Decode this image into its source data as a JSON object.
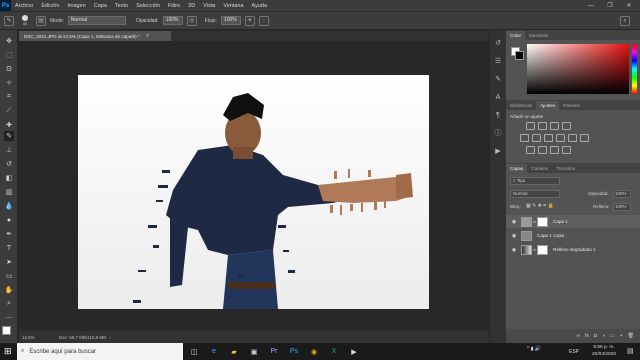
{
  "menu": {
    "app_icon": "Ps",
    "items": [
      "Archivo",
      "Edición",
      "Imagen",
      "Capa",
      "Texto",
      "Selección",
      "Filtro",
      "3D",
      "Vista",
      "Ventana",
      "Ayuda"
    ]
  },
  "options": {
    "brush_size": "40",
    "mode_label": "Modo:",
    "mode_value": "Normal",
    "opacity_label": "Opacidad:",
    "opacity_value": "100%",
    "flow_label": "Flujo:",
    "flow_value": "100%"
  },
  "document": {
    "tab_title": "DSC_5041.JPG al 12,5% (Capa 1, Máscara de capa/8) *",
    "zoom": "12,5%",
    "doc_info": "Doc: 66,7 MB/110,8 MB"
  },
  "color_panel": {
    "tabs": [
      "Color",
      "Muestras"
    ],
    "foreground": "#ffffff",
    "background": "#000000"
  },
  "adjust_panel": {
    "tabs": [
      "Bibliotecas",
      "Ajustes",
      "Paneles"
    ],
    "title": "Añadir un ajuste"
  },
  "layers_panel": {
    "tabs": [
      "Capas",
      "Canales",
      "Trazados"
    ],
    "filter_label": "Tipo",
    "blend_mode": "Normal",
    "opacity_label": "Opacidad:",
    "opacity_value": "100%",
    "lock_label": "Bloq.:",
    "fill_label": "Relleno:",
    "fill_value": "100%",
    "layers": [
      {
        "name": "Capa 1",
        "selected": true
      },
      {
        "name": "Capa 1 copia",
        "selected": false
      },
      {
        "name": "Relleno degradado 1",
        "selected": false
      }
    ]
  },
  "taskbar": {
    "search_placeholder": "Escribe aquí para buscar",
    "language": "ESP",
    "time": "5:56 p. m.",
    "date": "20/04/2020"
  },
  "colors": {
    "accent": "#31a8ff",
    "panel_bg": "#535353",
    "menu_bg": "#3c3c3c"
  }
}
